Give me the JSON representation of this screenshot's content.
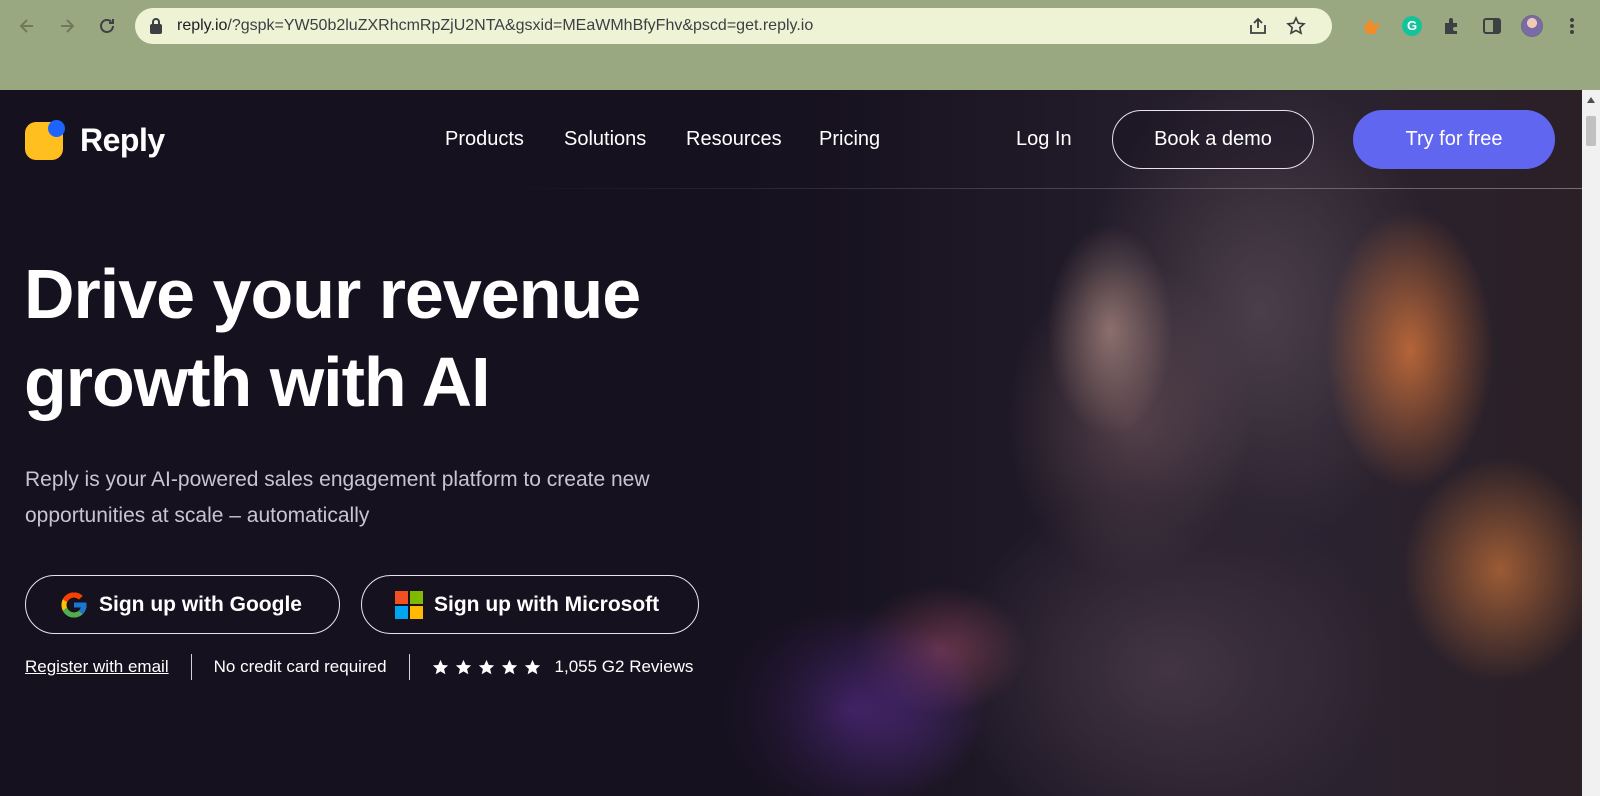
{
  "browser": {
    "url_host": "reply.io",
    "url_path": "/?gspk=YW50b2luZXRhcmRpZjU2NTA&gsxid=MEaWMhBfyFhv&pscd=get.reply.io",
    "icons": [
      "back-icon",
      "forward-icon",
      "reload-icon",
      "lock-icon",
      "share-icon",
      "bookmark-star-icon",
      "extension-icon",
      "grammarly-icon",
      "puzzle-icon",
      "side-panel-icon",
      "profile-avatar",
      "menu-icon"
    ],
    "grammarly_letter": "G"
  },
  "header": {
    "brand": "Reply",
    "nav": [
      "Products",
      "Solutions",
      "Resources",
      "Pricing"
    ],
    "login": "Log In",
    "demo_button": "Book a demo",
    "try_button": "Try for free"
  },
  "hero": {
    "headline_line1": "Drive your revenue",
    "headline_line2": "growth with AI",
    "subtitle_line1": "Reply is your AI-powered sales engagement platform to create new",
    "subtitle_line2": "opportunities at scale – automatically",
    "google_button": "Sign up with Google",
    "microsoft_button": "Sign up with Microsoft",
    "register_link": "Register with email",
    "no_card": "No credit card required",
    "rating_stars": 5,
    "reviews": "1,055 G2 Reviews"
  },
  "colors": {
    "chrome_bg": "#9aa882",
    "page_bg": "#16111f",
    "accent": "#6066f0",
    "logo_yellow": "#ffbf1f",
    "logo_blue": "#1f63ff"
  }
}
